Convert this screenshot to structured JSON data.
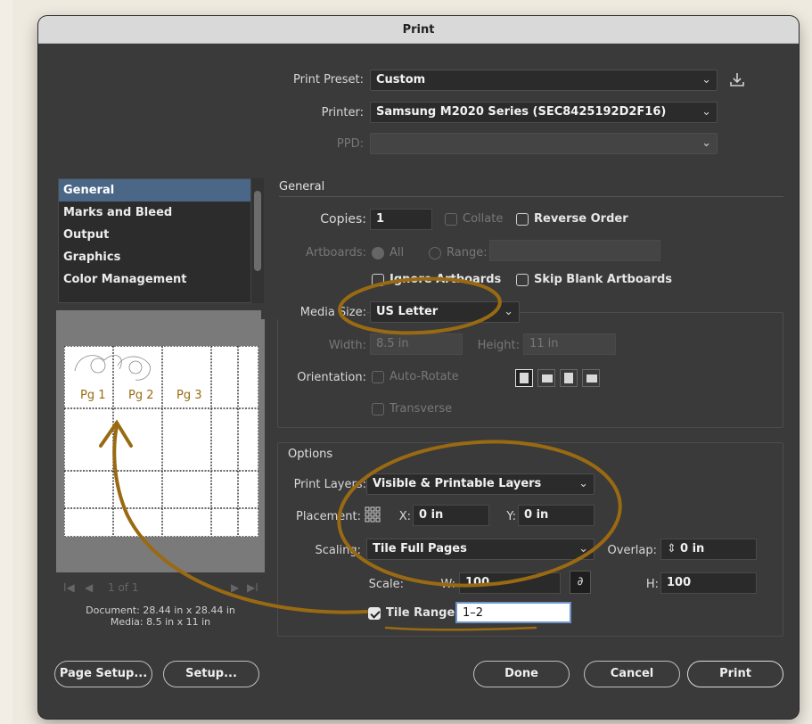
{
  "window": {
    "title": "Print"
  },
  "header": {
    "print_preset_label": "Print Preset:",
    "print_preset_value": "Custom",
    "printer_label": "Printer:",
    "printer_value": "Samsung M2020 Series (SEC8425192D2F16)",
    "ppd_label": "PPD:"
  },
  "sidebar": {
    "items": [
      {
        "label": "General",
        "selected": true
      },
      {
        "label": "Marks and Bleed"
      },
      {
        "label": "Output"
      },
      {
        "label": "Graphics"
      },
      {
        "label": "Color Management"
      }
    ]
  },
  "preview": {
    "pages": [
      "Pg 1",
      "Pg 2",
      "Pg 3"
    ],
    "pager_text": "1 of 1",
    "document_info": "Document: 28.44 in x 28.44 in",
    "media_info": "Media: 8.5 in x 11 in"
  },
  "general": {
    "section_title": "General",
    "copies_label": "Copies:",
    "copies_value": "1",
    "collate_label": "Collate",
    "reverse_order_label": "Reverse Order",
    "artboards_label": "Artboards:",
    "all_label": "All",
    "range_label": "Range:",
    "ignore_artboards_label": "Ignore Artboards",
    "skip_blank_label": "Skip Blank Artboards",
    "media_size_label": "Media Size:",
    "media_size_value": "US Letter",
    "width_label": "Width:",
    "width_value": "8.5 in",
    "height_label": "Height:",
    "height_value": "11 in",
    "orientation_label": "Orientation:",
    "auto_rotate_label": "Auto-Rotate",
    "transverse_label": "Transverse"
  },
  "options": {
    "section_title": "Options",
    "print_layers_label": "Print Layers:",
    "print_layers_value": "Visible & Printable Layers",
    "placement_label": "Placement:",
    "x_label": "X:",
    "x_value": "0 in",
    "y_label": "Y:",
    "y_value": "0 in",
    "scaling_label": "Scaling:",
    "scaling_value": "Tile Full Pages",
    "overlap_label": "Overlap:",
    "overlap_value": "0 in",
    "scale_label": "Scale:",
    "w_label": "W:",
    "w_value": "100",
    "h_label": "H:",
    "h_value": "100",
    "tile_range_label": "Tile Range:",
    "tile_range_value": "1–2"
  },
  "buttons": {
    "page_setup": "Page Setup...",
    "setup": "Setup...",
    "done": "Done",
    "cancel": "Cancel",
    "print": "Print"
  },
  "colors": {
    "annotation": "#9a6a12",
    "selection": "#4b6788",
    "window_bg": "#3a3a3a"
  }
}
